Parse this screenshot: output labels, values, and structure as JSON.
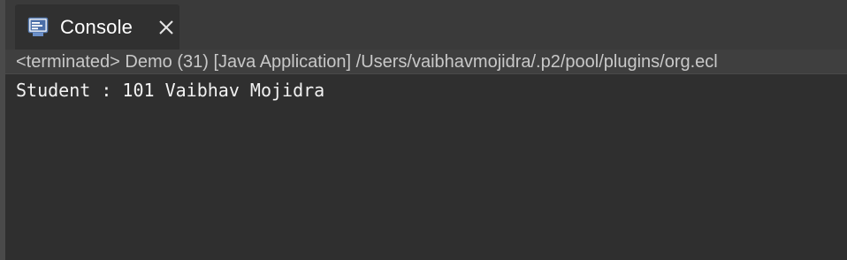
{
  "tab": {
    "label": "Console",
    "icon": "console-icon",
    "close_icon": "close-icon"
  },
  "status": {
    "text": "<terminated> Demo (31) [Java Application] /Users/vaibhavmojidra/.p2/pool/plugins/org.ecl"
  },
  "output": {
    "lines": [
      "Student : 101 Vaibhav Mojidra"
    ]
  },
  "colors": {
    "background": "#2f2f2f",
    "tabstrip": "#3a3a3a",
    "status_bar": "#3f3f3f",
    "text": "#f2f2f2",
    "status_text": "#c8c8c8"
  }
}
